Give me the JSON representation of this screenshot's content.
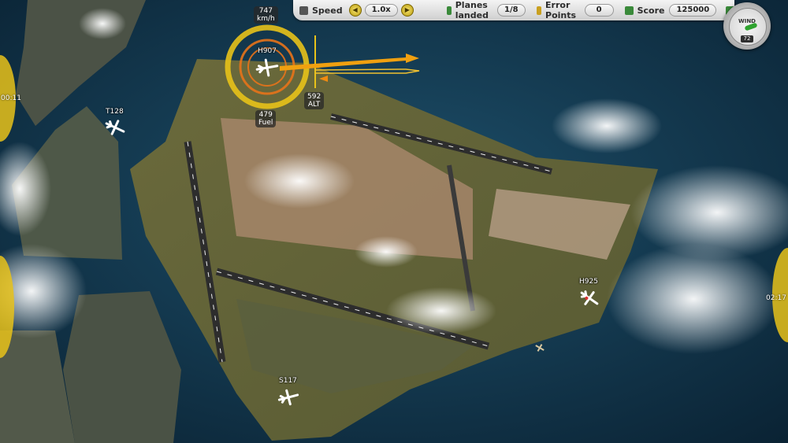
{
  "hud": {
    "speed_label": "Speed",
    "speed_value": "1.0x",
    "planes_landed_label": "Planes landed",
    "planes_landed_value": "1/8",
    "error_points_label": "Error Points",
    "error_points_value": "0",
    "score_label": "Score",
    "score_value": "125000"
  },
  "wind": {
    "label": "WIND",
    "value": "72"
  },
  "selected_plane": {
    "callsign": "H907",
    "speed_value": "747",
    "speed_unit": "km/h",
    "altitude_value": "592",
    "altitude_unit": "ALT",
    "fuel_value": "479",
    "fuel_unit": "Fuel"
  },
  "planes": [
    {
      "callsign": "T128"
    },
    {
      "callsign": "H925"
    },
    {
      "callsign": "S117"
    }
  ],
  "edge_timers": {
    "left": "00:11",
    "right": "02:17"
  },
  "colors": {
    "ring_yellow": "#e8c21a",
    "ring_orange": "#e8731a",
    "heading_arrow": "#f0a010",
    "hud_bg": "#dcdcdc"
  },
  "icons": {
    "speed": "speed-icon",
    "planes": "planes-landed-icon",
    "errors": "error-points-icon",
    "score": "score-icon",
    "menu": "menu-icon"
  }
}
